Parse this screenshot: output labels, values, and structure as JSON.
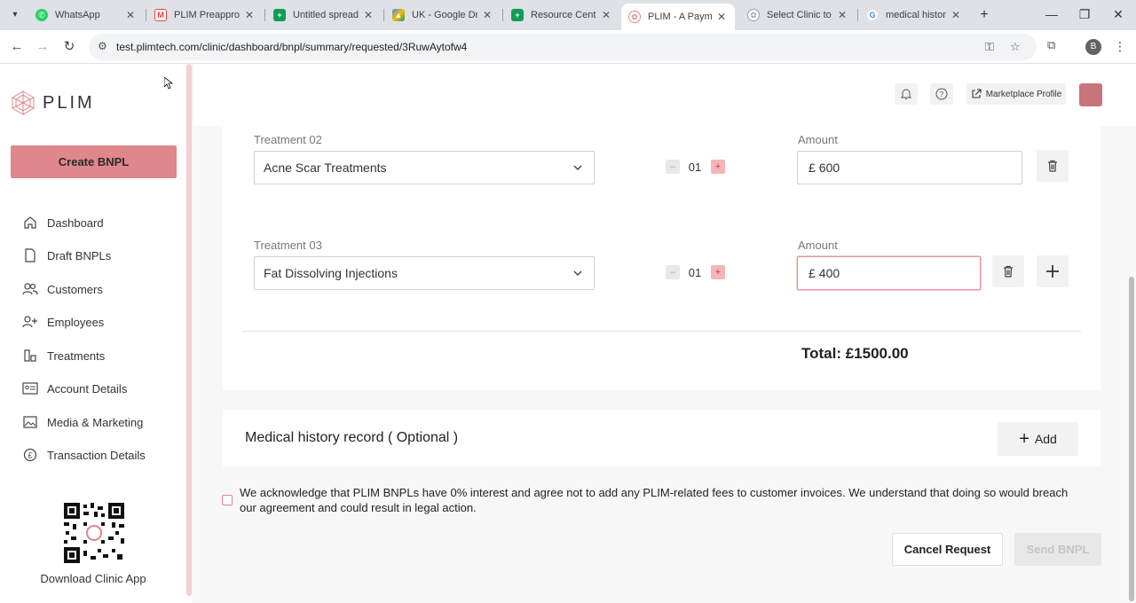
{
  "browser": {
    "tabs": [
      {
        "title": "WhatsApp",
        "icon": "whatsapp-icon",
        "color": "#25d366",
        "active": false
      },
      {
        "title": "PLIM Preapprova",
        "icon": "gmail-icon",
        "color": "#ea4335",
        "active": false
      },
      {
        "title": "Untitled spreads",
        "icon": "sheets-icon",
        "color": "#0f9d58",
        "active": false
      },
      {
        "title": "UK - Google Driv",
        "icon": "drive-icon",
        "color": "#4285f4",
        "active": false
      },
      {
        "title": "Resource Centre",
        "icon": "sheets-icon",
        "color": "#0f9d58",
        "active": false
      },
      {
        "title": "PLIM - A Paymen",
        "icon": "plim-icon",
        "color": "#e0868d",
        "active": true
      },
      {
        "title": "Select Clinic to c",
        "icon": "loading-icon",
        "color": "#9aa0a6",
        "active": false
      },
      {
        "title": "medical history c",
        "icon": "google-icon",
        "color": "#4285f4",
        "active": false
      }
    ],
    "url": "test.plimtech.com/clinic/dashboard/bnpl/summary/requested/3RuwAytofw4",
    "profile_initial": "B"
  },
  "sidebar": {
    "logo_text": "PLIM",
    "create_button": "Create BNPL",
    "items": [
      {
        "label": "Dashboard",
        "icon": "home-icon"
      },
      {
        "label": "Draft BNPLs",
        "icon": "document-icon"
      },
      {
        "label": "Customers",
        "icon": "users-icon"
      },
      {
        "label": "Employees",
        "icon": "add-user-icon"
      },
      {
        "label": "Treatments",
        "icon": "treatments-icon"
      },
      {
        "label": "Account Details",
        "icon": "id-card-icon"
      },
      {
        "label": "Media & Marketing",
        "icon": "image-icon"
      },
      {
        "label": "Transaction Details",
        "icon": "pound-icon"
      }
    ],
    "download_label": "Download Clinic App"
  },
  "header": {
    "marketplace_label": "Marketplace Profile"
  },
  "treatments": [
    {
      "label": "Treatment 02",
      "name": "Acne Scar Treatments",
      "qty": "01",
      "amount_label": "Amount",
      "currency": "£",
      "amount": "600"
    },
    {
      "label": "Treatment 03",
      "name": "Fat Dissolving Injections",
      "qty": "01",
      "amount_label": "Amount",
      "currency": "£",
      "amount": "400"
    }
  ],
  "total": "Total: £1500.00",
  "medical": {
    "title": "Medical history record ( Optional )",
    "add_label": "Add"
  },
  "acknowledgement": "We acknowledge that PLIM BNPLs have 0% interest and agree not to add any PLIM-related fees to customer invoices. We understand that doing so would breach our agreement and could result in legal action.",
  "actions": {
    "cancel": "Cancel Request",
    "send": "Send BNPL"
  },
  "colors": {
    "brand": "#e0868d",
    "stepper_plus": "#f5b5b9"
  }
}
